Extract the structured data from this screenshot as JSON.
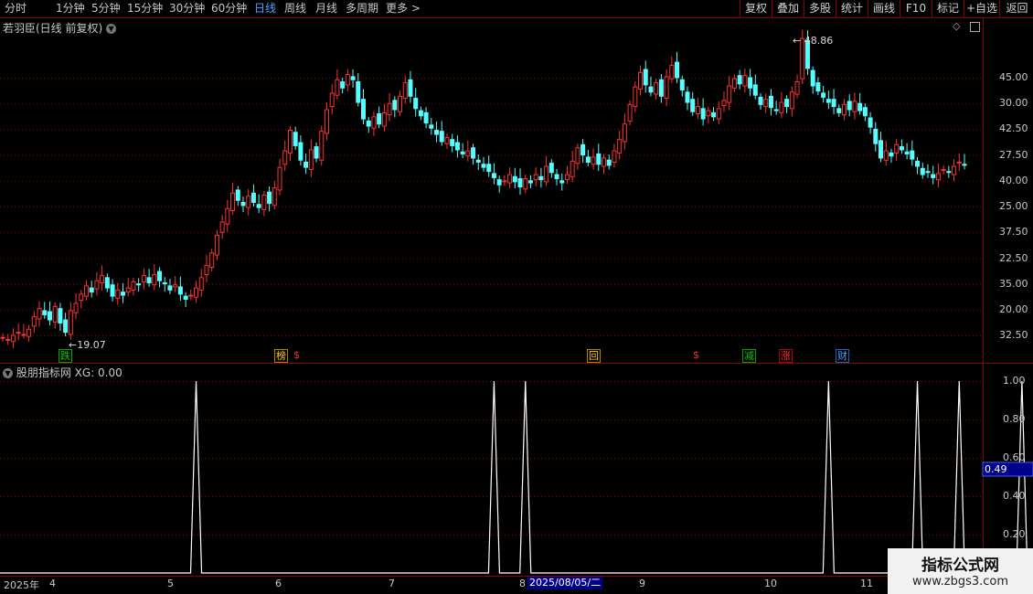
{
  "toolbar": {
    "periods": [
      "分时",
      "1分钟",
      "5分钟",
      "15分钟",
      "30分钟",
      "60分钟",
      "日线",
      "周线",
      "月线",
      "多周期",
      "更多 >"
    ],
    "active_period": "日线",
    "right_buttons": [
      "复权",
      "叠加",
      "多股",
      "统计",
      "画线",
      "F10",
      "+自选",
      "标记",
      "返回"
    ]
  },
  "main_chart": {
    "title": "若羽臣(日线 前复权)",
    "high_label": "48.86",
    "low_label": "19.07",
    "y_axis": [
      "45.00",
      "42.50",
      "40.00",
      "37.50",
      "35.00",
      "32.50",
      "30.00",
      "27.50",
      "25.00",
      "22.50",
      "20.00"
    ],
    "signals": [
      {
        "text": "跌",
        "color": "#00d000",
        "border": "#00a000"
      },
      {
        "text": "榜",
        "color": "#ffcc00",
        "border": "#b08000"
      },
      {
        "text": "$",
        "color": "#ff3030",
        "border": ""
      },
      {
        "text": "回",
        "color": "#ffcc00",
        "border": "#b08000"
      },
      {
        "text": "$",
        "color": "#ff3030",
        "border": ""
      },
      {
        "text": "减",
        "color": "#00d000",
        "border": "#00a000"
      },
      {
        "text": "涨",
        "color": "#ff3030",
        "border": "#b00000"
      },
      {
        "text": "财",
        "color": "#4ea0ff",
        "border": "#2060c0"
      }
    ]
  },
  "indicator": {
    "title": "股朋指标网",
    "xg_label": "XG: 0.00",
    "y_axis": [
      "1.00",
      "0.80",
      "0.60",
      "0.40",
      "0.20"
    ],
    "current_value": "0.49",
    "peaks_at_index": [
      37,
      94,
      100,
      158,
      175,
      183,
      195
    ]
  },
  "time_axis": {
    "year": "2025年",
    "months": [
      "4",
      "5",
      "6",
      "7",
      "8",
      "9",
      "10",
      "11"
    ],
    "cursor_date": "2025/08/05/二"
  },
  "watermark": {
    "line1": "指标公式网",
    "line2": "www.zbgs3.com"
  },
  "colors": {
    "up": "#ff3232",
    "down": "#54ffff",
    "grid": "#8b0000",
    "accent": "#4ea0ff"
  }
}
